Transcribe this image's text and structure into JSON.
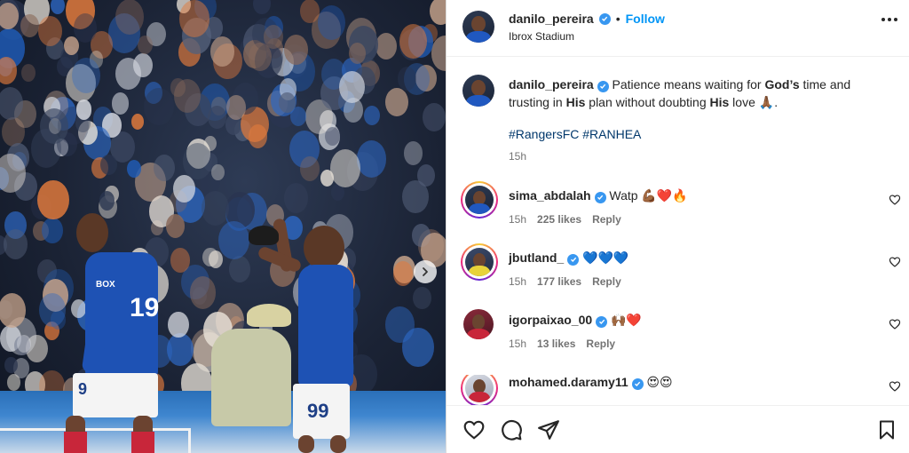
{
  "post": {
    "author": "danilo_pereira",
    "follow_label": "Follow",
    "separator": "•",
    "location": "Ibrox Stadium"
  },
  "photo": {
    "players": [
      {
        "number_front": "99",
        "number_back": "19"
      }
    ],
    "shirt_sponsor": "BOX",
    "next_icon": "chevron-right-icon"
  },
  "caption": {
    "author": "danilo_pereira",
    "text_part1": "Patience means waiting for ",
    "bold1": "God’s",
    "text_part2": " time and trusting in ",
    "bold2": "His",
    "text_part3": " plan without doubting ",
    "bold3": "His",
    "text_part4": " love 🙏🏾.",
    "hashtag1": "#RangersFC",
    "hashtag2": "#RANHEA",
    "time": "15h"
  },
  "comments": [
    {
      "user": "sima_abdalah",
      "text": "Watp 💪🏾❤️🔥",
      "time": "15h",
      "likes": "225 likes",
      "reply": "Reply"
    },
    {
      "user": "jbutland_",
      "text": "💙💙💙",
      "time": "15h",
      "likes": "177 likes",
      "reply": "Reply"
    },
    {
      "user": "igorpaixao_00",
      "text": "🙌🏾❤️",
      "time": "15h",
      "likes": "13 likes",
      "reply": "Reply"
    },
    {
      "user": "mohamed.daramy11",
      "text": "😍😍",
      "time": "",
      "likes": "",
      "reply": ""
    }
  ],
  "colors": {
    "follow": "#0095f6",
    "verified": "#3897f0",
    "hashtag": "#00376b",
    "kit_blue": "#1e52b4"
  },
  "icons": {
    "like": "heart-icon",
    "comment": "comment-icon",
    "share": "share-icon",
    "save": "bookmark-icon",
    "more": "more-icon"
  }
}
